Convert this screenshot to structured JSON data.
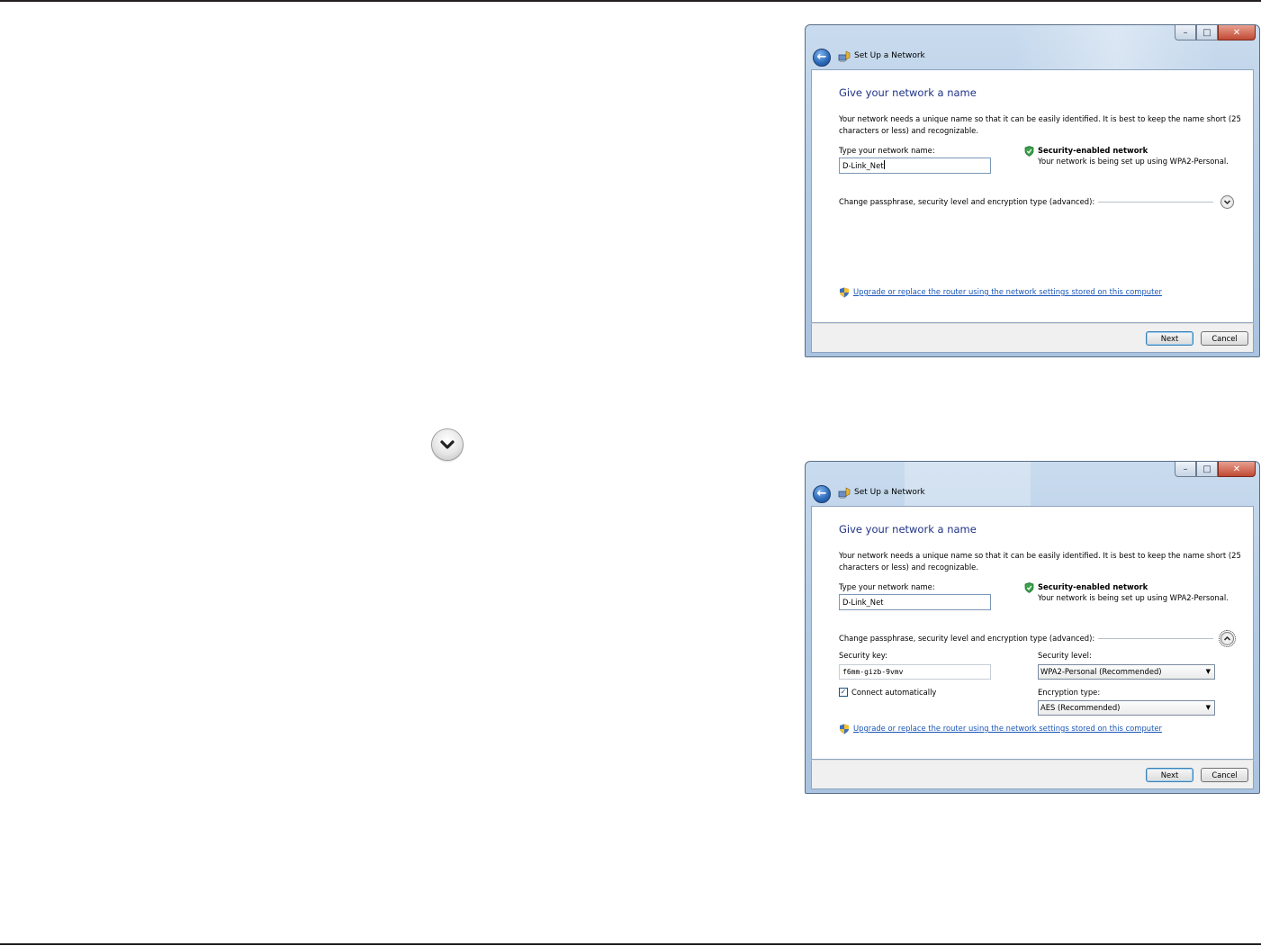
{
  "window": {
    "title": "Set Up a Network",
    "back_glyph": "←",
    "min_glyph": "–",
    "max_glyph": "□",
    "close_glyph": "✕"
  },
  "dialog": {
    "heading": "Give your network a name",
    "description": "Your network needs a unique name so that it can be easily identified. It is best to keep the name short (25 characters or less) and recognizable.",
    "name_label": "Type your network name:",
    "network_name": "D-Link_Net",
    "security_title": "Security-enabled network",
    "security_desc": "Your network is being set up using WPA2-Personal.",
    "advanced_label": "Change passphrase, security level and encryption type (advanced):",
    "upgrade_link": "Upgrade or replace the router using the network settings stored on this computer",
    "next_label": "Next",
    "cancel_label": "Cancel"
  },
  "advanced": {
    "security_key_label": "Security key:",
    "security_key": "f6mm-gizb-9vmv",
    "security_level_label": "Security level:",
    "security_level": "WPA2-Personal (Recommended)",
    "connect_auto_label": "Connect automatically",
    "connect_auto_checked": true,
    "encryption_label": "Encryption type:",
    "encryption": "AES (Recommended)"
  },
  "icons": {
    "expand": "chevron-down-icon",
    "collapse": "chevron-up-icon",
    "shield": "security-shield-icon",
    "uac_shield": "uac-shield-icon"
  },
  "colors": {
    "heading": "#1e3287",
    "link": "#1a56b8",
    "rule": "#231f20",
    "frame": "#b4cce6"
  }
}
